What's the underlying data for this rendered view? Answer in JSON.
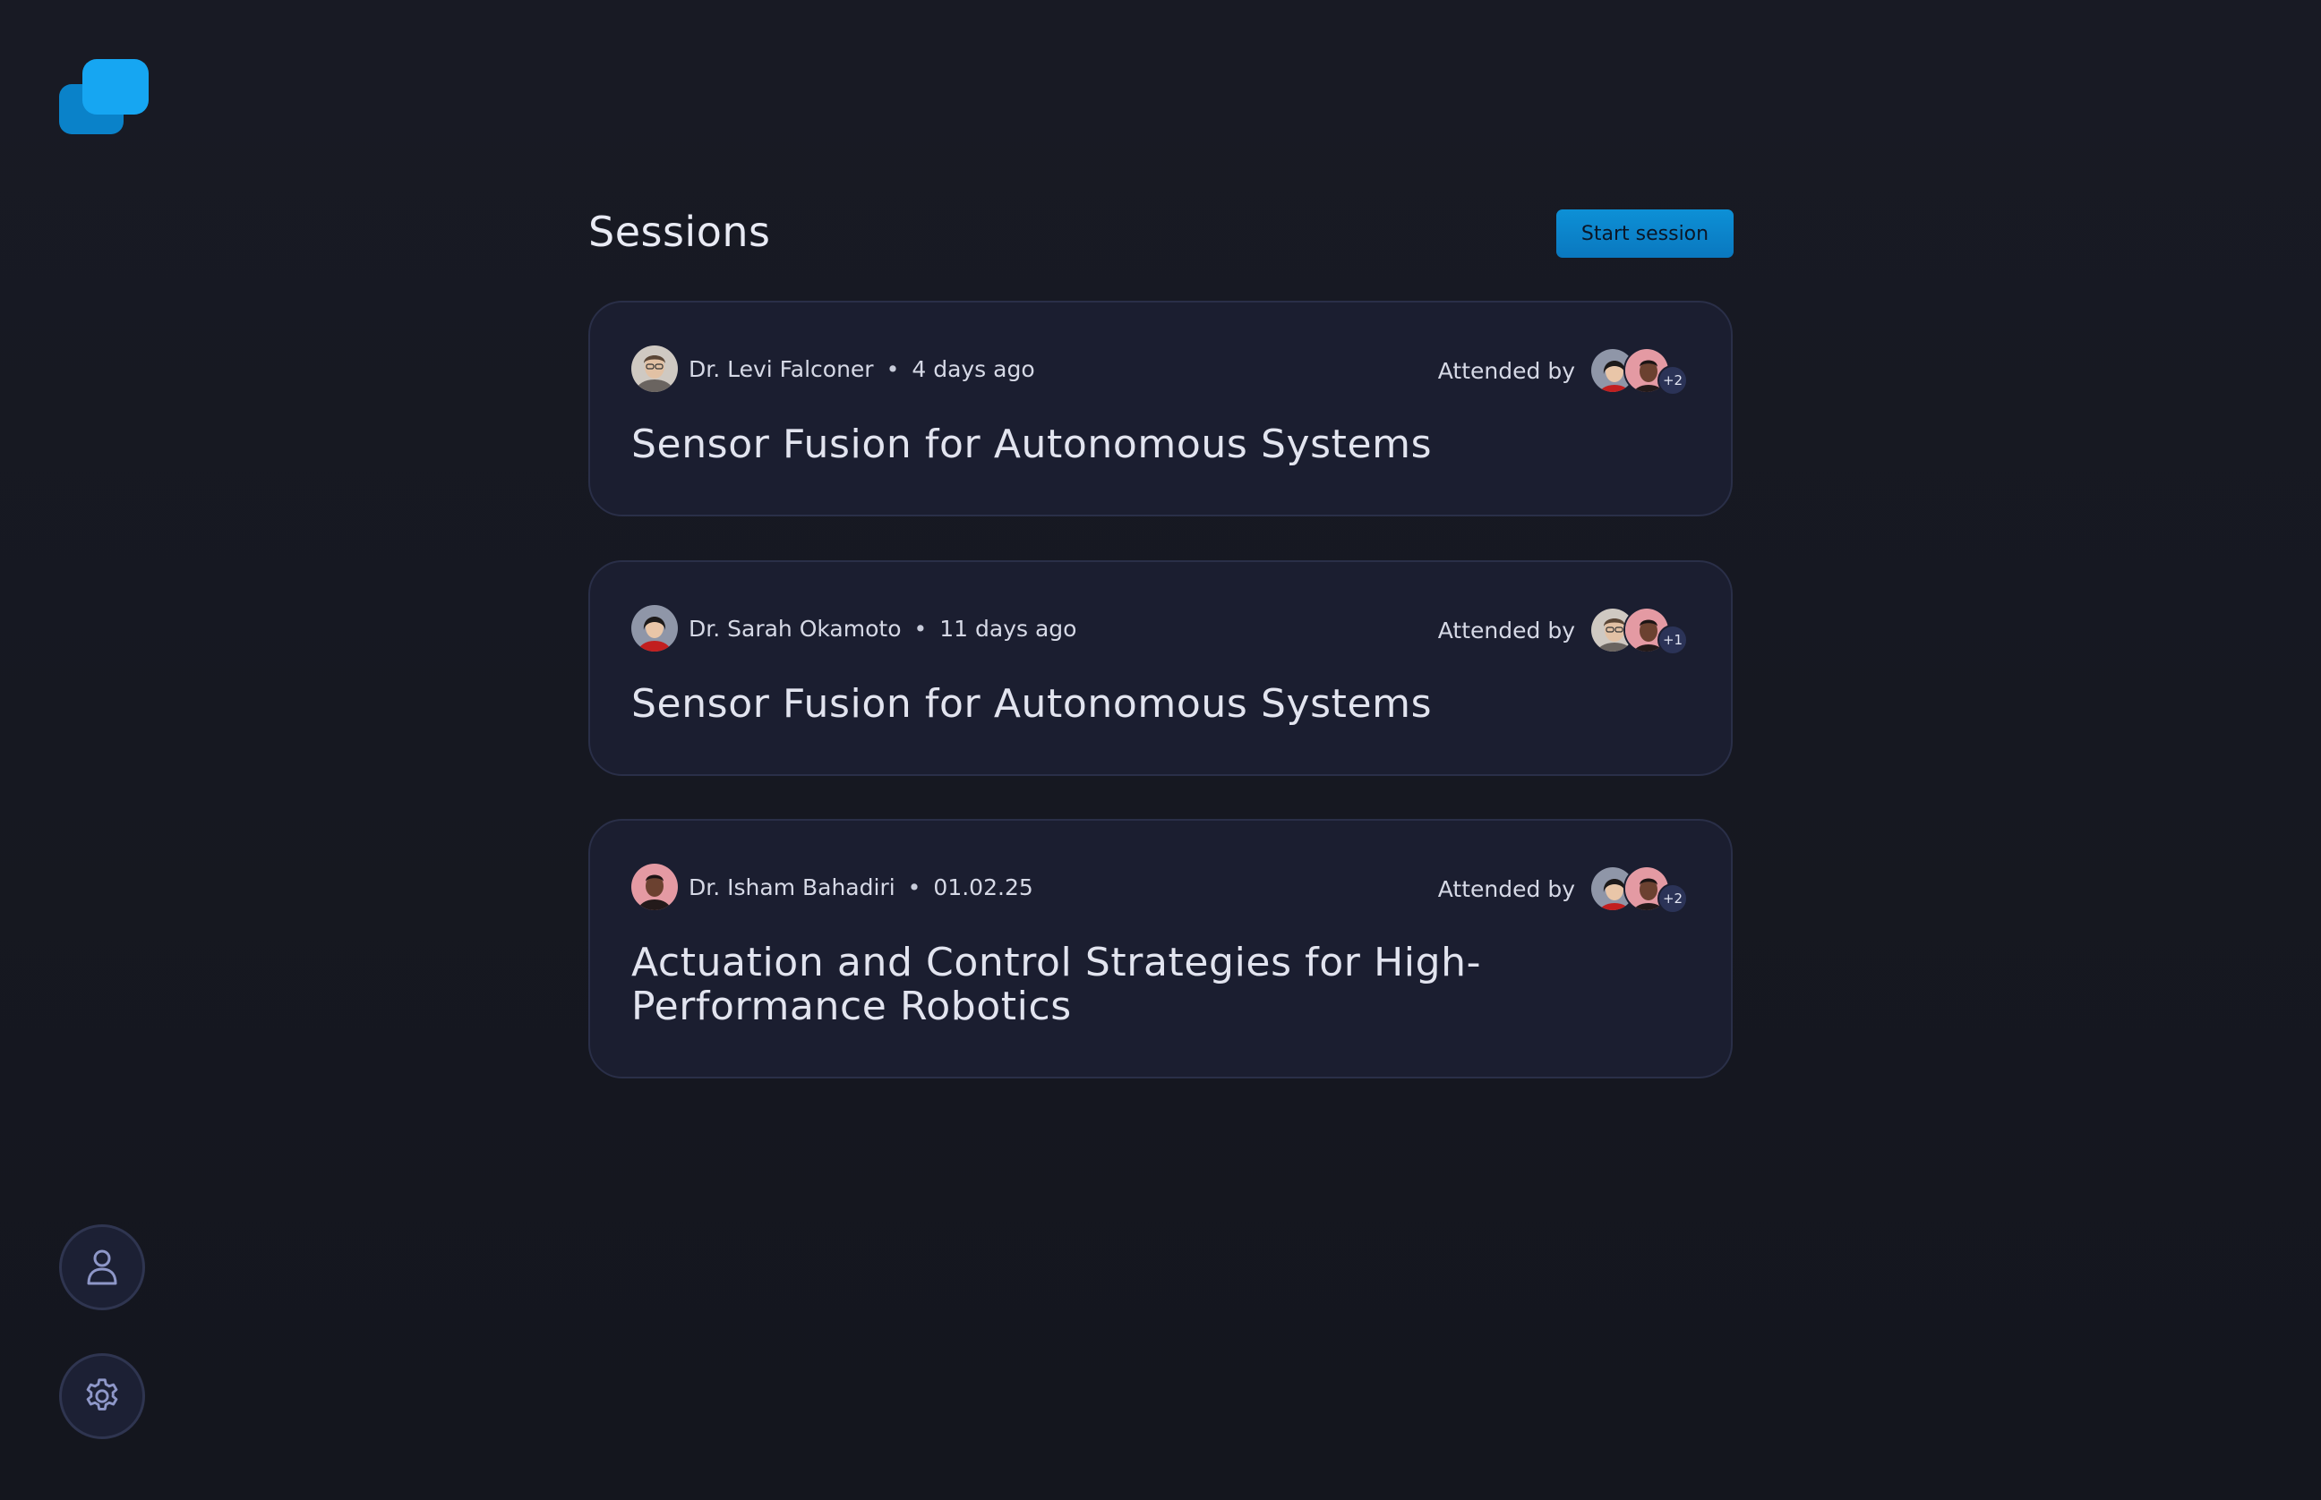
{
  "app": {
    "logo_icon": "chat-bubbles-logo",
    "accent_color": "#0d90d6"
  },
  "sidebar": {
    "items": [
      {
        "icon": "user-icon",
        "name": "profile"
      },
      {
        "icon": "gear-icon",
        "name": "settings"
      }
    ]
  },
  "header": {
    "title": "Sessions",
    "start_button_label": "Start session"
  },
  "sessions": [
    {
      "host": "Dr. Levi Falconer",
      "separator": "•",
      "time": "4 days ago",
      "attended_label": "Attended by",
      "more_count": "+2",
      "title": "Sensor Fusion for Autonomous Systems"
    },
    {
      "host": "Dr. Sarah Okamoto",
      "separator": "•",
      "time": "11 days ago",
      "attended_label": "Attended by",
      "more_count": "+1",
      "title": "Sensor Fusion for Autonomous Systems"
    },
    {
      "host": "Dr. Isham Bahadiri",
      "separator": "•",
      "time": "01.02.25",
      "attended_label": "Attended by",
      "more_count": "+2",
      "title": "Actuation and Control Strategies for High-Performance Robotics"
    }
  ]
}
